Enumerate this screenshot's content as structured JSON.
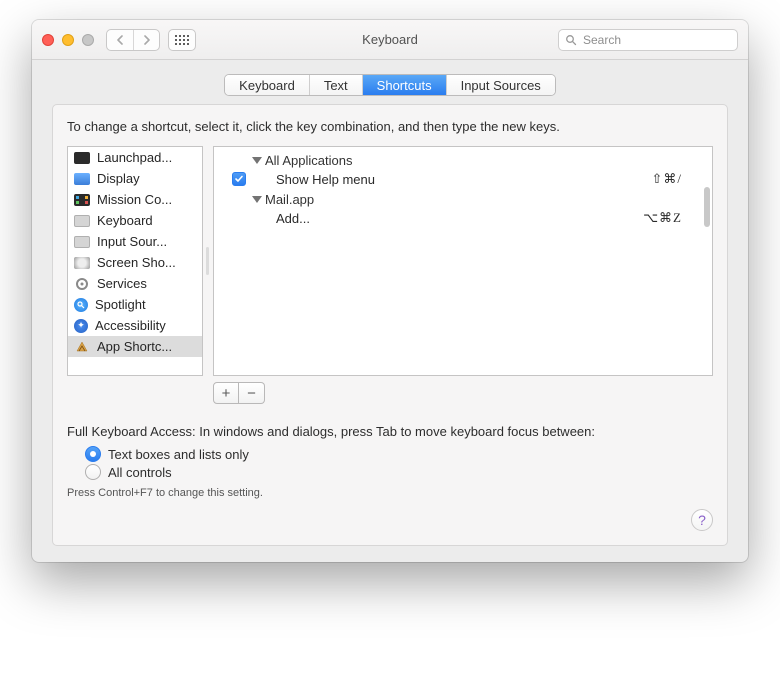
{
  "window": {
    "title": "Keyboard"
  },
  "toolbar": {
    "search_placeholder": "Search"
  },
  "tabs": [
    {
      "label": "Keyboard",
      "active": false
    },
    {
      "label": "Text",
      "active": false
    },
    {
      "label": "Shortcuts",
      "active": true
    },
    {
      "label": "Input Sources",
      "active": false
    }
  ],
  "panel": {
    "hint": "To change a shortcut, select it, click the key combination, and then type the new keys."
  },
  "sidebar": {
    "items": [
      {
        "label": "Launchpad..."
      },
      {
        "label": "Display"
      },
      {
        "label": "Mission Co..."
      },
      {
        "label": "Keyboard"
      },
      {
        "label": "Input Sour..."
      },
      {
        "label": "Screen Sho..."
      },
      {
        "label": "Services"
      },
      {
        "label": "Spotlight"
      },
      {
        "label": "Accessibility"
      },
      {
        "label": "App Shortc..."
      }
    ],
    "selected_index": 9
  },
  "detail": {
    "groups": [
      {
        "title": "All Applications",
        "rows": [
          {
            "checked": true,
            "label": "Show Help menu",
            "shortcut": "⇧⌘/"
          }
        ]
      },
      {
        "title": "Mail.app",
        "rows": [
          {
            "checked": null,
            "label": "Add...",
            "shortcut": "⌥⌘Z"
          }
        ]
      }
    ]
  },
  "buttons": {
    "add": "+",
    "remove": "−"
  },
  "fka": {
    "label": "Full Keyboard Access: In windows and dialogs, press Tab to move keyboard focus between:",
    "options": [
      {
        "label": "Text boxes and lists only",
        "checked": true
      },
      {
        "label": "All controls",
        "checked": false
      }
    ],
    "note": "Press Control+F7 to change this setting."
  },
  "help": {
    "label": "?"
  }
}
